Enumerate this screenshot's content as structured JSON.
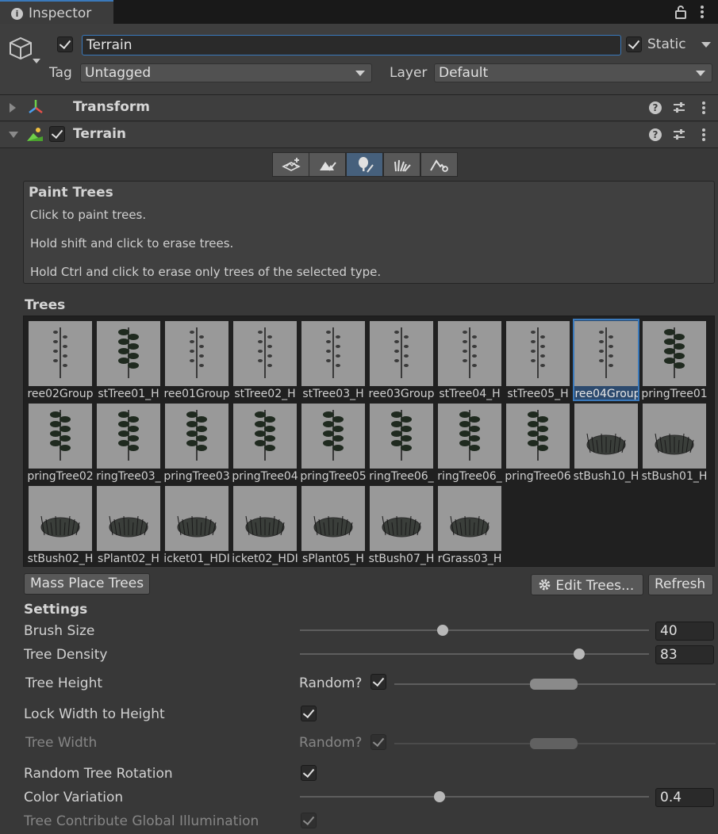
{
  "tab": {
    "title": "Inspector"
  },
  "gameobject": {
    "name": "Terrain",
    "active": true,
    "static_label": "Static",
    "static": true,
    "tag_label": "Tag",
    "tag_value": "Untagged",
    "layer_label": "Layer",
    "layer_value": "Default"
  },
  "components": [
    {
      "title": "Transform",
      "expanded": false
    },
    {
      "title": "Terrain",
      "expanded": true,
      "enabled": true
    }
  ],
  "toolbar": {
    "tools": [
      "create-neighbor-terrains-icon",
      "paint-terrain-icon",
      "paint-trees-icon",
      "paint-details-icon",
      "terrain-settings-icon"
    ],
    "active_index": 2
  },
  "help": {
    "title": "Paint Trees",
    "lines": [
      "Click to paint trees.",
      "Hold shift and click to erase trees.",
      "Hold Ctrl and click to erase only trees of the selected type."
    ]
  },
  "trees": {
    "title": "Trees",
    "items": [
      "ree02Group",
      "stTree01_H",
      "ree01Group",
      "stTree02_H",
      "stTree03_H",
      "ree03Group",
      "stTree04_H",
      "stTree05_H",
      "ree04Group",
      "pringTree01",
      "pringTree02",
      "ringTree03_",
      "pringTree03",
      "pringTree04",
      "pringTree05",
      "ringTree06_",
      "ringTree06_",
      "pringTree06",
      "stBush10_H",
      "stBush01_H",
      "stBush02_H",
      "sPlant02_H",
      "icket01_HDI",
      "icket02_HDI",
      "sPlant05_H",
      "stBush07_H",
      "rGrass03_H"
    ],
    "selected_index": 8
  },
  "buttons": {
    "mass_place": "Mass Place Trees",
    "edit_trees": "Edit Trees...",
    "refresh": "Refresh"
  },
  "settings": {
    "title": "Settings",
    "brush_size_label": "Brush Size",
    "brush_size_value": "40",
    "brush_size_fraction": 0.41,
    "tree_density_label": "Tree Density",
    "tree_density_value": "83",
    "tree_density_fraction": 0.8,
    "tree_height_label": "Tree Height",
    "tree_height_random_label": "Random?",
    "tree_height_random": true,
    "lock_width_label": "Lock Width to Height",
    "lock_width": true,
    "tree_width_label": "Tree Width",
    "tree_width_random_label": "Random?",
    "tree_width_random": true,
    "random_rotation_label": "Random Tree Rotation",
    "random_rotation": true,
    "color_variation_label": "Color Variation",
    "color_variation_value": "0.4",
    "color_variation_fraction": 0.4,
    "contribute_gi_label": "Tree Contribute Global Illumination",
    "contribute_gi": true
  },
  "colors": {
    "accent": "#3a79bb",
    "panel": "#383838",
    "header": "#3e3e3e",
    "thumb_bg": "#999999"
  }
}
